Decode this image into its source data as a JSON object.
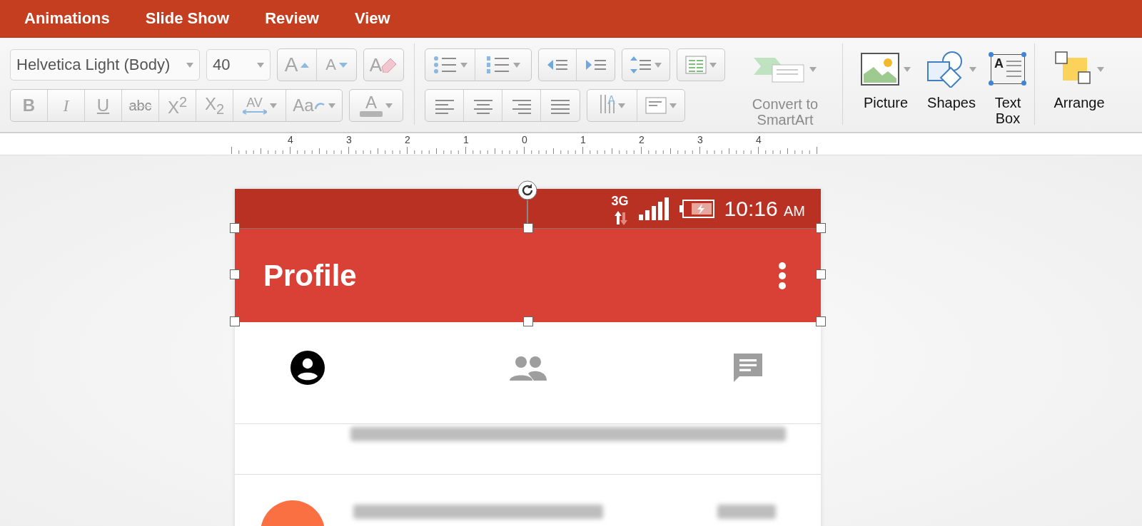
{
  "menu_tabs": [
    {
      "label": "Animations"
    },
    {
      "label": "Slide Show"
    },
    {
      "label": "Review"
    },
    {
      "label": "View"
    }
  ],
  "ribbon": {
    "font_name": "Helvetica Light (Body)",
    "font_size": "40",
    "grow_font": "A",
    "shrink_font": "A",
    "clear_format": "A",
    "format_buttons": [
      {
        "kind": "bold",
        "label": "B"
      },
      {
        "kind": "italic",
        "label": "I"
      },
      {
        "kind": "underline",
        "label": "U"
      },
      {
        "kind": "strike",
        "label": "abc"
      },
      {
        "kind": "super",
        "label": "X$^{2}$"
      },
      {
        "kind": "sub",
        "label": "X$_{2}$"
      },
      {
        "kind": "spacing",
        "label": "AV"
      },
      {
        "kind": "case",
        "label": "Aa"
      }
    ],
    "font_color": "A",
    "text_direction": "A",
    "convert": "Convert to SmartArt",
    "insert_buttons": [
      {
        "kind": "picture",
        "label": "Picture"
      },
      {
        "kind": "shapes",
        "label": "Shapes"
      },
      {
        "kind": "textbox",
        "label": "Text Box",
        "icon_text": "A"
      },
      {
        "kind": "arrange",
        "label": "Arrange"
      }
    ]
  },
  "ruler": {
    "labels": [
      "4",
      "3",
      "2",
      "1",
      "0",
      "1",
      "2",
      "3",
      "4"
    ]
  },
  "slide": {
    "status_bar": {
      "network": "3G",
      "time": "10:16",
      "meridiem": "AM"
    },
    "app_bar": {
      "title": "Profile"
    },
    "tabs": [
      {
        "kind": "person",
        "selected": true
      },
      {
        "kind": "group",
        "selected": false
      },
      {
        "kind": "chat",
        "selected": false
      }
    ],
    "list_rows": [
      {
        "kind": "text"
      },
      {
        "kind": "avatar"
      }
    ]
  }
}
